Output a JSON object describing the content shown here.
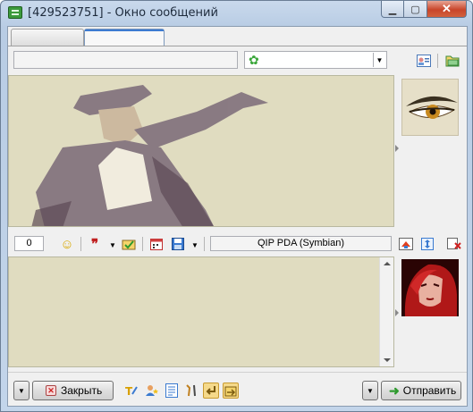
{
  "window": {
    "title": "[429523751] - Окно сообщений"
  },
  "window_controls": {
    "minimize": "▁",
    "maximize": "▢",
    "close": "✕"
  },
  "tabs": [
    {
      "label": ""
    },
    {
      "label": ""
    }
  ],
  "contact": {
    "nick_value": "",
    "status_icon": "clover-icon"
  },
  "counter": {
    "value": "0"
  },
  "client_info": {
    "label": "QIP PDA (Symbian)"
  },
  "buttons": {
    "close_label": "Закрыть",
    "send_label": "Отправить"
  },
  "colors": {
    "history_bg": "#e0dcc0",
    "accent": "#3d7bd1"
  }
}
